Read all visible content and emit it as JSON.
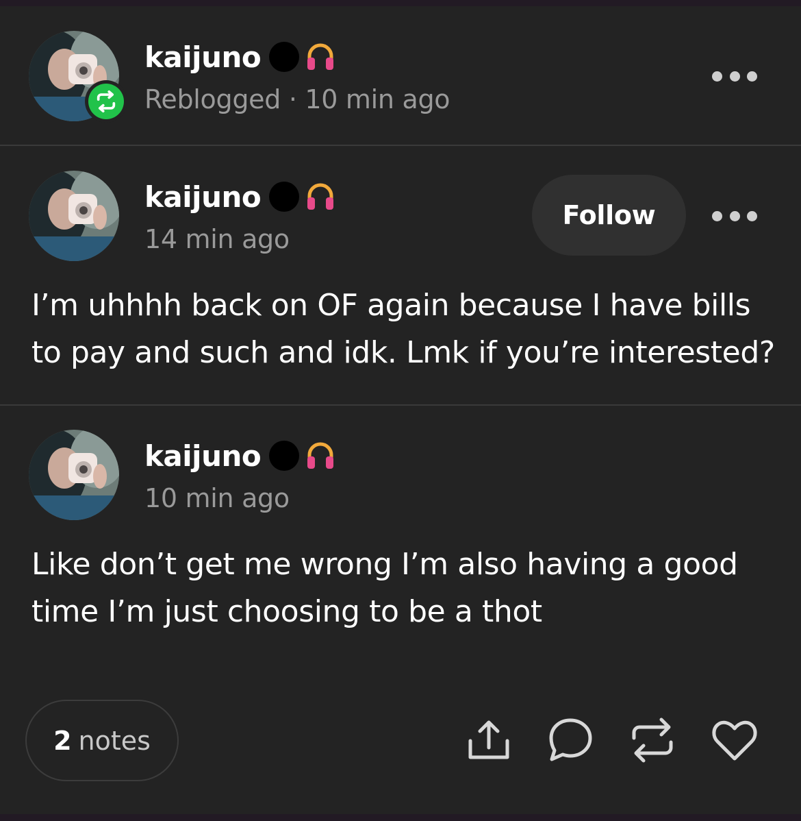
{
  "colors": {
    "background": "#232323",
    "reblog_green": "#21c24a",
    "muted_text": "#9a9a9a",
    "follow_bg": "#303030"
  },
  "reblog_header": {
    "username": "kaijuno",
    "status": "Reblogged",
    "separator": "·",
    "time": "10 min ago"
  },
  "original_post": {
    "username": "kaijuno",
    "time": "14 min ago",
    "follow_label": "Follow",
    "text": "I’m uhhhh back on OF again because I have bills to pay and such and idk. Lmk if you’re interested?"
  },
  "reblog_comment": {
    "username": "kaijuno",
    "time": "10 min ago",
    "text": "Like don’t get me wrong I’m also having a good time I’m just choosing to be a thot"
  },
  "footer": {
    "notes_count": "2",
    "notes_label": "notes",
    "icons": [
      "share-icon",
      "comment-icon",
      "reblog-icon",
      "like-icon"
    ]
  }
}
